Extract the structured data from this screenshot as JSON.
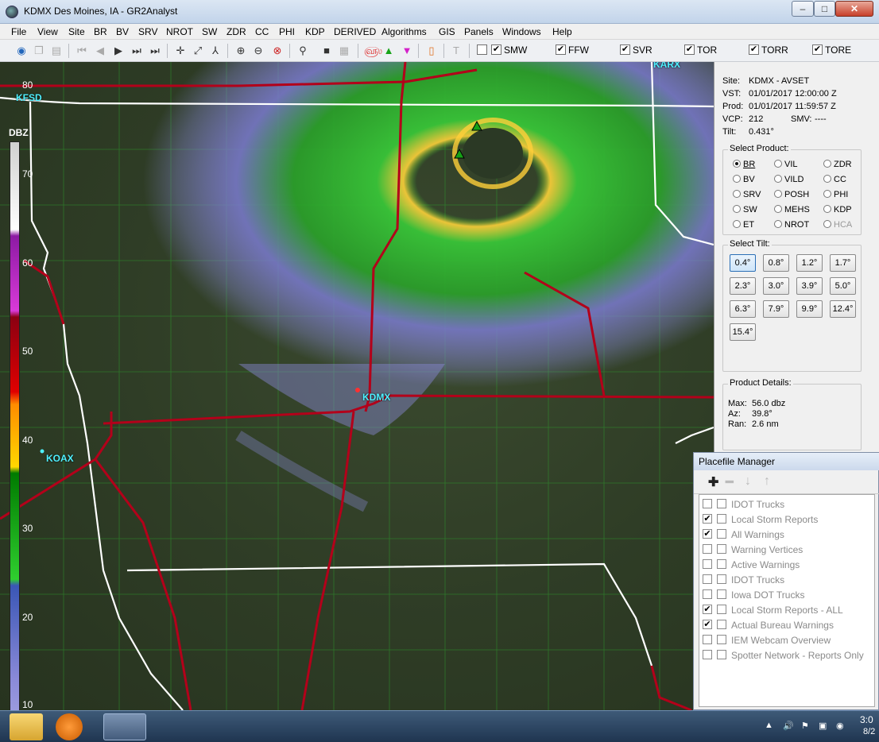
{
  "window": {
    "title": "KDMX Des Moines, IA - GR2Analyst",
    "min": "–",
    "max": "□",
    "close": "✕"
  },
  "menu": [
    "File",
    "View",
    "Site",
    "BR",
    "BV",
    "SRV",
    "NROT",
    "SW",
    "ZDR",
    "CC",
    "PHI",
    "KDP",
    "DERIVED",
    "Algorithms",
    "GIS",
    "Panels",
    "Windows",
    "Help"
  ],
  "toolbar": {
    "checks": [
      {
        "label": "SMW",
        "checked": true
      },
      {
        "label": "FFW",
        "checked": true
      },
      {
        "label": "SVR",
        "checked": true
      },
      {
        "label": "TOR",
        "checked": true
      },
      {
        "label": "TORR",
        "checked": true
      },
      {
        "label": "TORE",
        "checked": true
      }
    ]
  },
  "colorbar": {
    "title": "DBZ",
    "ticks": [
      "80",
      "70",
      "60",
      "50",
      "40",
      "30",
      "20",
      "10"
    ]
  },
  "sites": {
    "kdmx": "KDMX",
    "koax": "KOAX",
    "kfsd": "KFSD",
    "kara": "KARX"
  },
  "info": {
    "site_label": "Site:",
    "site": "KDMX - AVSET",
    "vst_label": "VST:",
    "vst": "01/01/2017  12:00:00 Z",
    "prod_label": "Prod:",
    "prod": "01/01/2017  11:59:57 Z",
    "vcp_label": "VCP:",
    "vcp": "212",
    "smv_label": "SMV:",
    "smv": "----",
    "tilt_label": "Tilt:",
    "tilt": "0.431°"
  },
  "select_product": {
    "legend": "Select Product:",
    "items": [
      {
        "label": "BR",
        "selected": true
      },
      {
        "label": "VIL"
      },
      {
        "label": "ZDR"
      },
      {
        "label": "BV"
      },
      {
        "label": "VILD"
      },
      {
        "label": "CC"
      },
      {
        "label": "SRV"
      },
      {
        "label": "POSH"
      },
      {
        "label": "PHI"
      },
      {
        "label": "SW"
      },
      {
        "label": "MEHS"
      },
      {
        "label": "KDP"
      },
      {
        "label": "ET"
      },
      {
        "label": "NROT"
      },
      {
        "label": "HCA",
        "disabled": true
      }
    ]
  },
  "select_tilt": {
    "legend": "Select Tilt:",
    "items": [
      "0.4°",
      "0.8°",
      "1.2°",
      "1.7°",
      "2.3°",
      "3.0°",
      "3.9°",
      "5.0°",
      "6.3°",
      "7.9°",
      "9.9°",
      "12.4°",
      "15.4°"
    ],
    "selected": "0.4°"
  },
  "details": {
    "legend": "Product Details:",
    "max_label": "Max:",
    "max": "56.0 dbz",
    "az_label": "Az:",
    "az": "39.8°",
    "ran_label": "Ran:",
    "ran": "2.6 nm"
  },
  "placefile": {
    "title": "Placefile Manager",
    "items": [
      {
        "label": "IDOT Trucks",
        "checked": false
      },
      {
        "label": "Local Storm Reports",
        "checked": true
      },
      {
        "label": "All Warnings",
        "checked": true
      },
      {
        "label": "Warning Vertices",
        "checked": false
      },
      {
        "label": "Active Warnings",
        "checked": false
      },
      {
        "label": "IDOT Trucks",
        "checked": false
      },
      {
        "label": "Iowa DOT Trucks",
        "checked": false
      },
      {
        "label": "Local Storm Reports - ALL",
        "checked": true
      },
      {
        "label": "Actual Bureau Warnings",
        "checked": true
      },
      {
        "label": "IEM Webcam Overview",
        "checked": false
      },
      {
        "label": "Spotter Network - Reports Only",
        "checked": false
      }
    ]
  },
  "taskbar": {
    "clock": "3:0",
    "date": "8/2"
  }
}
